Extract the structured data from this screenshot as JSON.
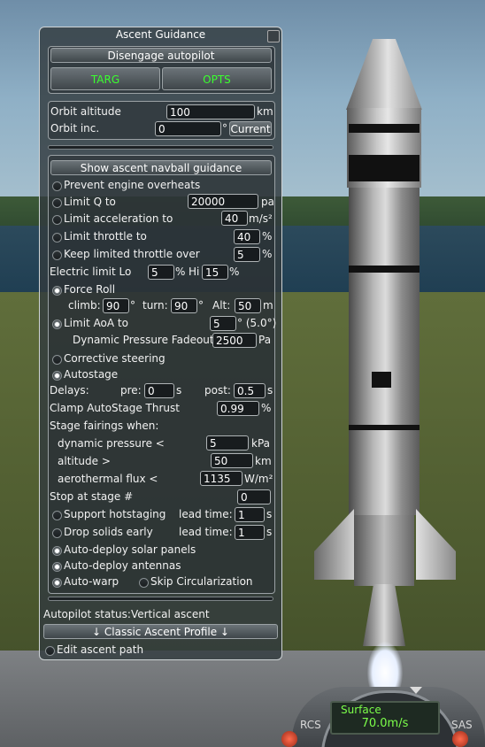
{
  "window": {
    "title": "Ascent Guidance"
  },
  "buttons": {
    "disengage": "Disengage autopilot",
    "targ": "TARG",
    "opts": "OPTS",
    "current": "Current",
    "navball_guidance": "Show ascent navball guidance",
    "classic_profile": "↓ Classic Ascent Profile ↓"
  },
  "orbit": {
    "altitude_label": "Orbit altitude",
    "altitude_value": "100",
    "altitude_unit": "km",
    "inc_label": "Orbit inc.",
    "inc_value": "0",
    "inc_unit": "°"
  },
  "options": {
    "prevent_overheats": {
      "label": "Prevent engine overheats",
      "checked": false
    },
    "limit_q": {
      "label": "Limit Q to",
      "value": "20000",
      "unit": "pa",
      "checked": false
    },
    "limit_accel": {
      "label": "Limit acceleration to",
      "value": "40",
      "unit": "m/s²",
      "checked": false
    },
    "limit_throttle": {
      "label": "Limit throttle to",
      "value": "40",
      "unit": "%",
      "checked": false
    },
    "keep_limited": {
      "label": "Keep limited throttle over",
      "value": "5",
      "unit": "%",
      "checked": false
    },
    "electric": {
      "label": "Electric limit Lo",
      "lo_value": "5",
      "lo_unit": "%",
      "hi_label": "Hi",
      "hi_value": "15",
      "hi_unit": "%"
    },
    "force_roll": {
      "label": "Force Roll",
      "checked": true,
      "climb_label": "climb:",
      "climb_value": "90",
      "turn_label": "turn:",
      "turn_value": "90",
      "deg": "°",
      "alt_label": "Alt:",
      "alt_value": "50",
      "alt_unit": "m"
    },
    "limit_aoa": {
      "label": "Limit AoA to",
      "value": "5",
      "unit": "° (5.0°)",
      "checked": true
    },
    "dyn_fadeout": {
      "label": "Dynamic Pressure Fadeout",
      "value": "2500",
      "unit": "Pa"
    },
    "corrective": {
      "label": "Corrective steering",
      "checked": false
    },
    "autostage": {
      "label": "Autostage",
      "checked": true
    },
    "delays": {
      "label": "Delays:",
      "pre_label": "pre:",
      "pre_value": "0",
      "post_label": "post:",
      "post_value": "0.5",
      "unit": "s"
    },
    "clamp": {
      "label": "Clamp AutoStage Thrust",
      "value": "0.99",
      "unit": "%"
    },
    "fairings": {
      "label": "Stage fairings when:",
      "dyn_label": "dynamic pressure <",
      "dyn_value": "5",
      "dyn_unit": "kPa",
      "alt_label": "altitude >",
      "alt_value": "50",
      "alt_unit": "km",
      "flux_label": "aerothermal flux <",
      "flux_value": "1135",
      "flux_unit": "W/m²"
    },
    "stop_stage": {
      "label": "Stop at stage #",
      "value": "0"
    },
    "hotstaging": {
      "label": "Support hotstaging",
      "checked": false,
      "lead_label": "lead time:",
      "lead_value": "1",
      "unit": "s"
    },
    "drop_solids": {
      "label": "Drop solids early",
      "checked": false,
      "lead_label": "lead time:",
      "lead_value": "1",
      "unit": "s"
    },
    "solar": {
      "label": "Auto-deploy solar panels",
      "checked": true
    },
    "antennas": {
      "label": "Auto-deploy antennas",
      "checked": true
    },
    "autowarp": {
      "label": "Auto-warp",
      "checked": true
    },
    "skip_circ": {
      "label": "Skip Circularization",
      "checked": false
    }
  },
  "status": {
    "label": "Autopilot status:",
    "value": "Vertical ascent"
  },
  "edit_path": {
    "label": "Edit ascent path",
    "checked": false
  },
  "navball": {
    "mode": "Surface",
    "speed": "70.0m/s",
    "rcs": "RCS",
    "sas": "SAS"
  },
  "colors": {
    "green": "#3bff2f",
    "panel": "#323a3e"
  }
}
